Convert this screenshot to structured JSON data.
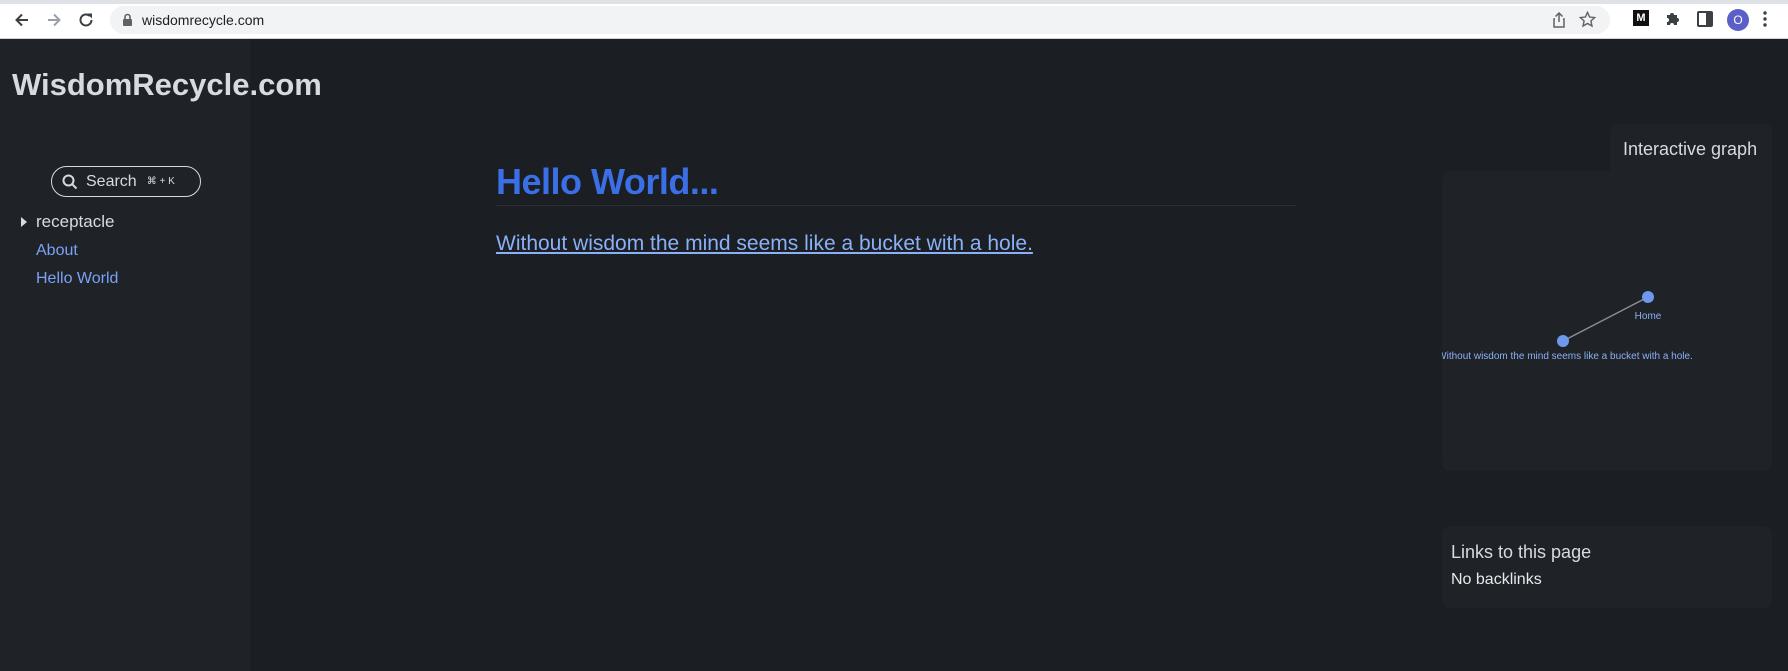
{
  "browser": {
    "url": "wisdomrecycle.com",
    "avatar_letter": "O",
    "extension_label": "M"
  },
  "sidebar": {
    "site_title": "WisdomRecycle.com",
    "search_label": "Search",
    "search_shortcut": "⌘ + K",
    "folder_label": "receptacle",
    "links": [
      "About",
      "Hello World"
    ]
  },
  "main": {
    "title": "Hello World...",
    "link_text": "Without wisdom the mind seems like a bucket with a hole."
  },
  "graph": {
    "title": "Interactive graph",
    "nodes": [
      {
        "label": "Home"
      },
      {
        "label": "Without wisdom the mind seems like a bucket with a hole."
      }
    ]
  },
  "backlinks": {
    "title": "Links to this page",
    "empty_text": "No backlinks"
  },
  "colors": {
    "accent": "#3b6fe6",
    "link": "#7aa2f7",
    "background": "#1b1e23",
    "panel": "#1f2227"
  }
}
